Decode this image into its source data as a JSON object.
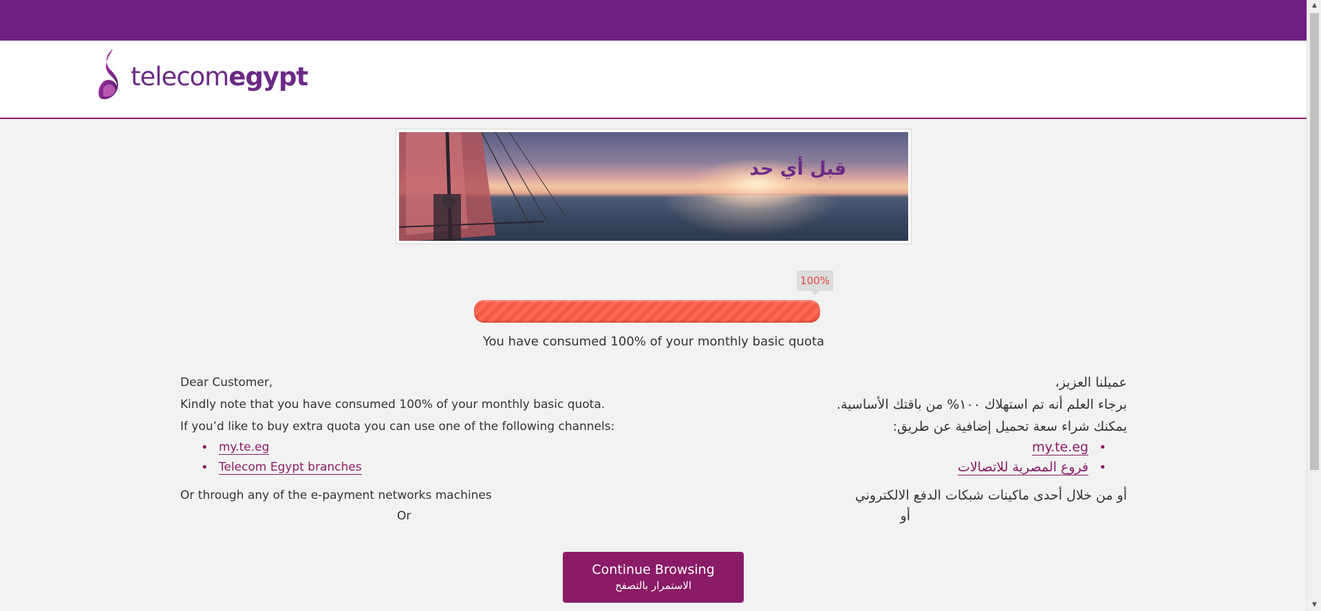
{
  "brand": {
    "logo_light": "telecom",
    "logo_bold": "egypt",
    "primary_color": "#6f1f80",
    "accent_color": "#8a1b66",
    "logo_icon": "telecom-egypt-swirl-icon"
  },
  "banner": {
    "tagline": "قبل أي حد"
  },
  "quota": {
    "percent_label": "100%",
    "percent_value": 100,
    "caption": "You have consumed 100% of your monthly basic quota"
  },
  "english": {
    "greeting": "Dear Customer,",
    "note": "Kindly note that you have consumed 100% of your monthly basic quota.",
    "channels_intro": "If you’d like to buy extra quota you can use one of the following channels:",
    "links": [
      {
        "label": "my.te.eg"
      },
      {
        "label": "Telecom Egypt branches"
      }
    ],
    "epayment": "Or through any of the e-payment networks machines",
    "or": "Or"
  },
  "arabic": {
    "greeting": "عميلنا العزيز،",
    "note": "برجاء العلم أنه تم استهلاك ١٠٠% من باقتك الأساسية.",
    "channels_intro": "يمكنك شراء سعة تحميل إضافية عن طريق:",
    "links": [
      {
        "label": "my.te.eg"
      },
      {
        "label": "فروع المصرية للاتصالات"
      }
    ],
    "epayment": "أو من خلال أحدى ماكينات شبكات الدفع الالكتروني",
    "or": "أو"
  },
  "continue_button": {
    "label_en": "Continue Browsing",
    "label_ar": "الاستمرار بالتصفح"
  }
}
